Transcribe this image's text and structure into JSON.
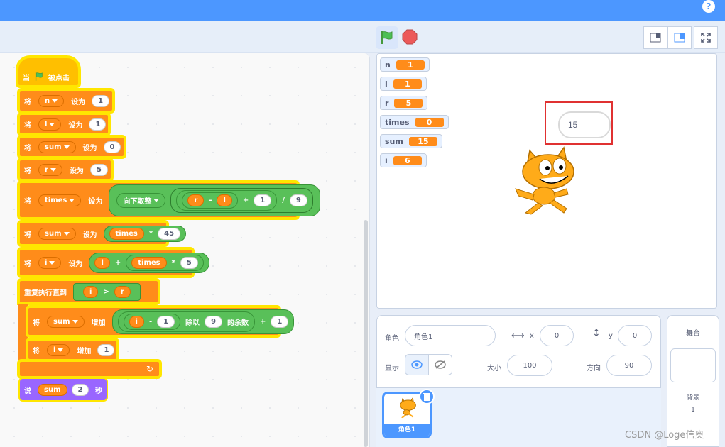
{
  "header": {
    "help_label": "?"
  },
  "toolbar": {
    "green_flag": "green-flag-icon",
    "stop": "stop-icon"
  },
  "script": {
    "hat": {
      "when": "当",
      "clicked": "被点击"
    },
    "set_n": {
      "kw": "将",
      "var": "n",
      "to": "设为",
      "value": "1"
    },
    "set_l": {
      "kw": "将",
      "var": "l",
      "to": "设为",
      "value": "1"
    },
    "set_sum": {
      "kw": "将",
      "var": "sum",
      "to": "设为",
      "value": "0"
    },
    "set_r": {
      "kw": "将",
      "var": "r",
      "to": "设为",
      "value": "5"
    },
    "set_times": {
      "kw": "将",
      "var": "times",
      "to": "设为",
      "func": "向下取整",
      "a": "r",
      "minus": "-",
      "b": "l",
      "plus": "+",
      "c": "1",
      "div": "/",
      "d": "9"
    },
    "set_sum2": {
      "kw": "将",
      "var": "sum",
      "to": "设为",
      "a": "times",
      "mul": "*",
      "b": "45"
    },
    "set_i": {
      "kw": "将",
      "var": "i",
      "to": "设为",
      "a": "l",
      "plus": "+",
      "b": "times",
      "mul": "*",
      "c": "5"
    },
    "repeat": {
      "label": "重复执行直到",
      "a": "i",
      "gt": ">",
      "b": "r"
    },
    "change_sum": {
      "kw": "将",
      "var": "sum",
      "by": "增加",
      "a": "i",
      "minus": "-",
      "b": "1",
      "mod1": "除以",
      "c": "9",
      "mod2": "的余数",
      "plus": "+",
      "d": "1"
    },
    "change_i": {
      "kw": "将",
      "var": "i",
      "by": "增加",
      "value": "1"
    },
    "say": {
      "label": "说",
      "var": "sum",
      "secs": "2",
      "unit": "秒"
    }
  },
  "monitors": [
    {
      "name": "n",
      "value": "1"
    },
    {
      "name": "l",
      "value": "1"
    },
    {
      "name": "r",
      "value": "5"
    },
    {
      "name": "times",
      "value": "0"
    },
    {
      "name": "sum",
      "value": "15"
    },
    {
      "name": "i",
      "value": "6"
    }
  ],
  "stage": {
    "bubble": "15"
  },
  "sprite_info": {
    "sprite_label": "角色",
    "sprite_name": "角色1",
    "x_label": "x",
    "x_value": "0",
    "y_label": "y",
    "y_value": "0",
    "show_label": "显示",
    "size_label": "大小",
    "size_value": "100",
    "direction_label": "方向",
    "direction_value": "90"
  },
  "sprites": [
    {
      "name": "角色1"
    }
  ],
  "stage_panel": {
    "title": "舞台",
    "backdrops_label": "背景",
    "backdrops_count": "1"
  },
  "watermark": "CSDN @Loge信奥"
}
